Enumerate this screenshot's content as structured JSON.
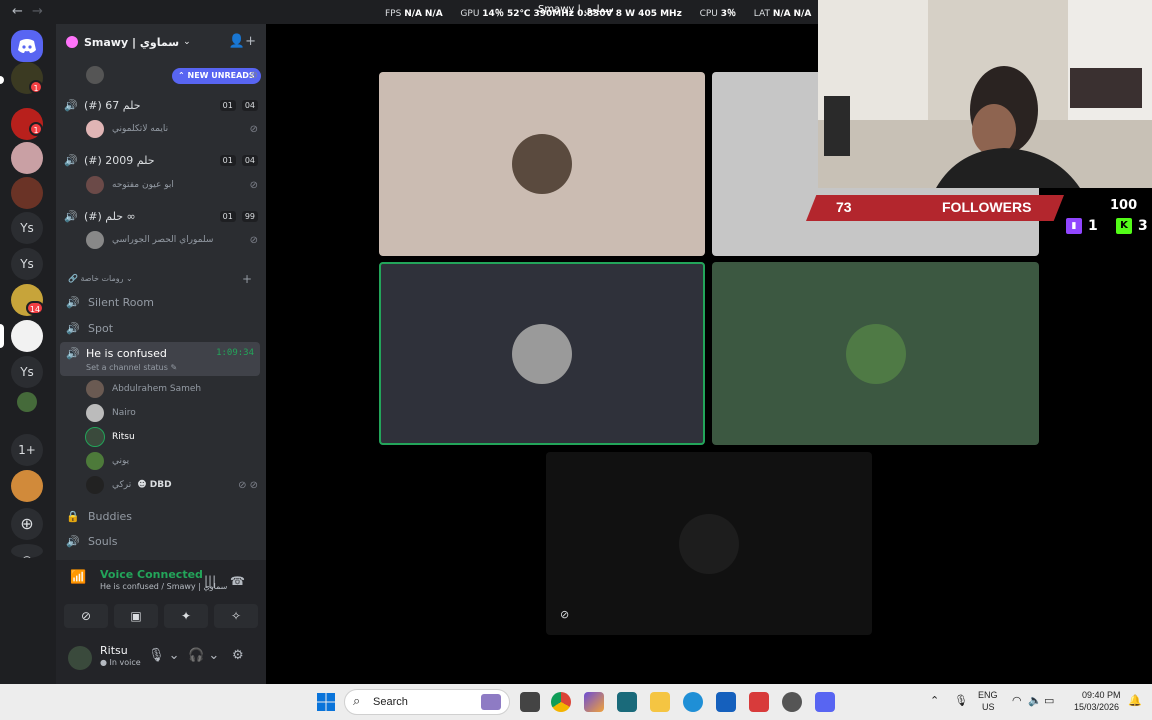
{
  "topbar": {
    "back": "←",
    "forward": "→",
    "fps_label": "FPS",
    "fps_value": "N/A",
    "fps_value2": "N/A",
    "gpu_label": "GPU",
    "gpu_value": "14％ 52℃ 390MHz 0.830V 8 W 405 MHz",
    "cpu_label": "CPU",
    "cpu_value": "3％",
    "lat_label": "LAT",
    "lat_value": "N/A",
    "lat_value2": "N/A",
    "title": "Smawy | سماوي"
  },
  "rail": {
    "text_servers": [
      "Ys",
      "Ys",
      "Ys",
      "1+"
    ],
    "badges": [
      "1",
      "1",
      "14"
    ]
  },
  "sidebar": {
    "server_name": "Smawy | سماوي",
    "new_unreads": "NEW UNREADS",
    "channels": [
      {
        "name": "(#) حلم 67",
        "counts": [
          "01",
          "04"
        ],
        "member": "نايمه لاتكلموني"
      },
      {
        "name": "(#) حلم 2009",
        "counts": [
          "01",
          "04"
        ],
        "member": "ابو عيون مفتوحه"
      },
      {
        "name": "(#) حلم ∞",
        "counts": [
          "01",
          "99"
        ],
        "member": "سلموراي الحصر الجوراسي"
      }
    ],
    "category": "رومات خاصة",
    "voice_channels": [
      "Silent Room",
      "Spot"
    ],
    "active_channel": {
      "name": "He is confused",
      "time": "1:09:34",
      "status": "Set a channel status"
    },
    "voice_members": [
      "Abdulrahem Sameh",
      "Nairo",
      "Ritsu",
      "يوني",
      "تركي"
    ],
    "dbd_tag": "DBD",
    "more_channels": [
      "Buddies",
      "Souls"
    ]
  },
  "voice": {
    "title": "Voice Connected",
    "subtitle": "He is confused / Smawy | سماوي"
  },
  "user": {
    "name": "Ritsu",
    "status": "In voice"
  },
  "stream": {
    "followers_count": "73",
    "followers_label": "FOLLOWERS",
    "goal": "100",
    "twitch_count": "1",
    "kick_count": "3"
  },
  "taskbar": {
    "search_label": "Search",
    "lang": "ENG",
    "region": "US",
    "time": "09:40 PM",
    "date": "15/03/2026"
  },
  "colors": {
    "discord_green": "#23a55a",
    "blurple": "#5865f2",
    "followers_red": "#b3262d",
    "twitch": "#9146ff",
    "kick": "#53fc18"
  }
}
